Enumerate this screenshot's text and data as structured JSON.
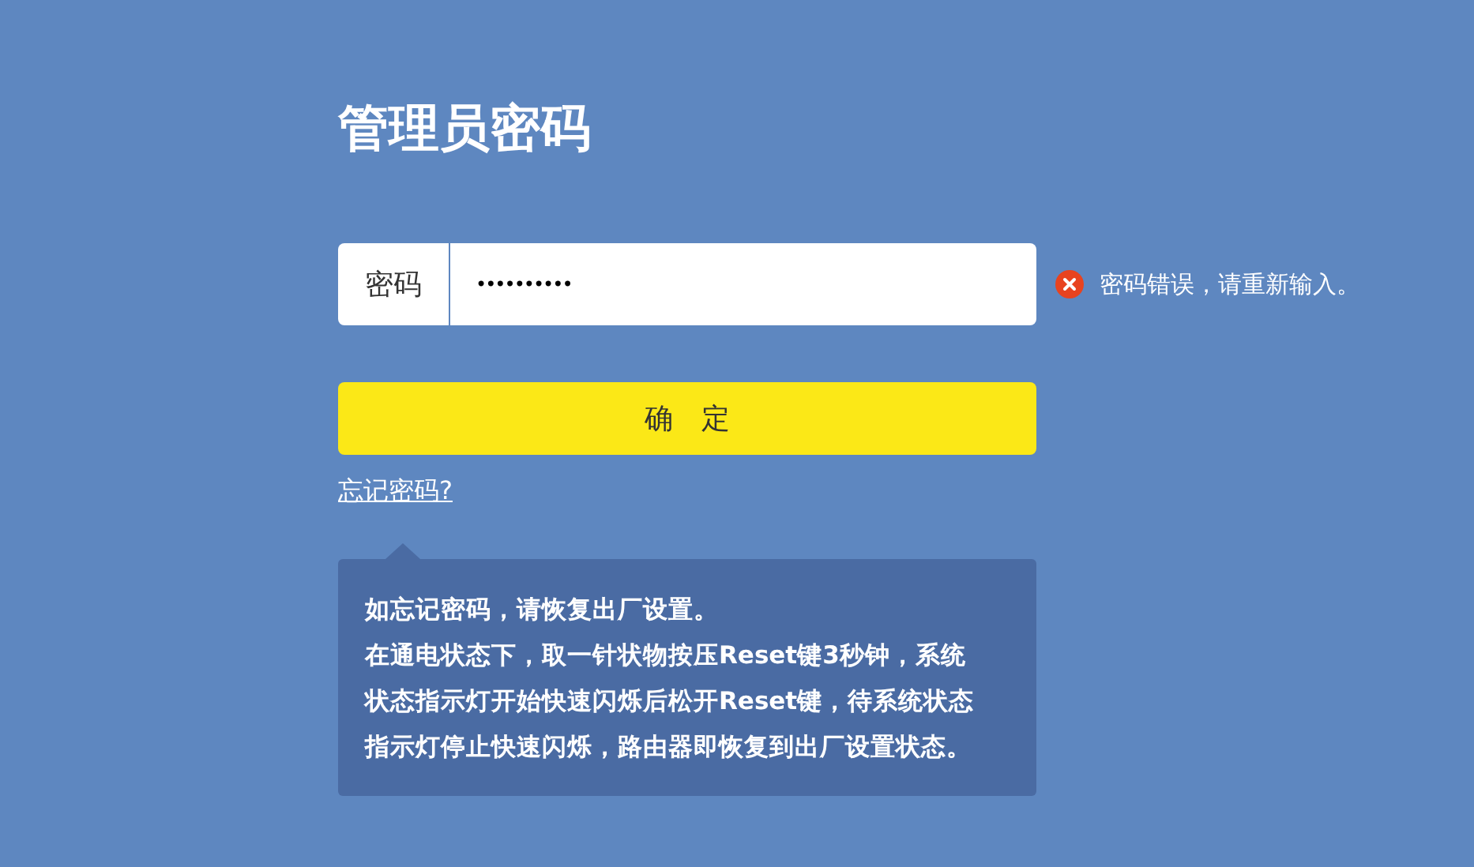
{
  "title": "管理员密码",
  "password_field": {
    "label": "密码",
    "value": "••••••••••"
  },
  "error": {
    "message": "密码错误，请重新输入。"
  },
  "confirm_button": {
    "label": "确　定"
  },
  "forgot_link": {
    "label": "忘记密码?"
  },
  "help_tooltip": {
    "paragraphs": [
      "如忘记密码，请恢复出厂设置。",
      "在通电状态下，取一针状物按压Reset键3秒钟，系统状态指示灯开始快速闪烁后松开Reset键，待系统状态指示灯停止快速闪烁，路由器即恢复到出厂设置状态。"
    ]
  }
}
